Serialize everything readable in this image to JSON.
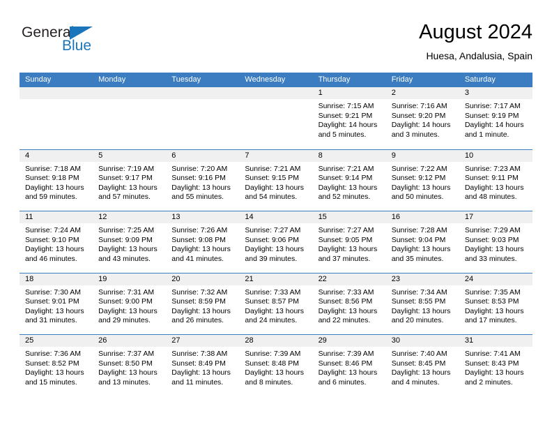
{
  "brand": {
    "name_top": "General",
    "name_bottom": "Blue",
    "accent_color": "#1b75bb",
    "triangle_icon": "triangle-icon"
  },
  "header": {
    "title": "August 2024",
    "subtitle": "Huesa, Andalusia, Spain"
  },
  "calendar": {
    "header_bg": "#3b7dc0",
    "day_head_bg": "#f0f0f0",
    "weekdays": [
      "Sunday",
      "Monday",
      "Tuesday",
      "Wednesday",
      "Thursday",
      "Friday",
      "Saturday"
    ],
    "weeks": [
      [
        {
          "day": "",
          "lines": []
        },
        {
          "day": "",
          "lines": []
        },
        {
          "day": "",
          "lines": []
        },
        {
          "day": "",
          "lines": []
        },
        {
          "day": "1",
          "lines": [
            "Sunrise: 7:15 AM",
            "Sunset: 9:21 PM",
            "Daylight: 14 hours",
            "and 5 minutes."
          ]
        },
        {
          "day": "2",
          "lines": [
            "Sunrise: 7:16 AM",
            "Sunset: 9:20 PM",
            "Daylight: 14 hours",
            "and 3 minutes."
          ]
        },
        {
          "day": "3",
          "lines": [
            "Sunrise: 7:17 AM",
            "Sunset: 9:19 PM",
            "Daylight: 14 hours",
            "and 1 minute."
          ]
        }
      ],
      [
        {
          "day": "4",
          "lines": [
            "Sunrise: 7:18 AM",
            "Sunset: 9:18 PM",
            "Daylight: 13 hours",
            "and 59 minutes."
          ]
        },
        {
          "day": "5",
          "lines": [
            "Sunrise: 7:19 AM",
            "Sunset: 9:17 PM",
            "Daylight: 13 hours",
            "and 57 minutes."
          ]
        },
        {
          "day": "6",
          "lines": [
            "Sunrise: 7:20 AM",
            "Sunset: 9:16 PM",
            "Daylight: 13 hours",
            "and 55 minutes."
          ]
        },
        {
          "day": "7",
          "lines": [
            "Sunrise: 7:21 AM",
            "Sunset: 9:15 PM",
            "Daylight: 13 hours",
            "and 54 minutes."
          ]
        },
        {
          "day": "8",
          "lines": [
            "Sunrise: 7:21 AM",
            "Sunset: 9:14 PM",
            "Daylight: 13 hours",
            "and 52 minutes."
          ]
        },
        {
          "day": "9",
          "lines": [
            "Sunrise: 7:22 AM",
            "Sunset: 9:12 PM",
            "Daylight: 13 hours",
            "and 50 minutes."
          ]
        },
        {
          "day": "10",
          "lines": [
            "Sunrise: 7:23 AM",
            "Sunset: 9:11 PM",
            "Daylight: 13 hours",
            "and 48 minutes."
          ]
        }
      ],
      [
        {
          "day": "11",
          "lines": [
            "Sunrise: 7:24 AM",
            "Sunset: 9:10 PM",
            "Daylight: 13 hours",
            "and 46 minutes."
          ]
        },
        {
          "day": "12",
          "lines": [
            "Sunrise: 7:25 AM",
            "Sunset: 9:09 PM",
            "Daylight: 13 hours",
            "and 43 minutes."
          ]
        },
        {
          "day": "13",
          "lines": [
            "Sunrise: 7:26 AM",
            "Sunset: 9:08 PM",
            "Daylight: 13 hours",
            "and 41 minutes."
          ]
        },
        {
          "day": "14",
          "lines": [
            "Sunrise: 7:27 AM",
            "Sunset: 9:06 PM",
            "Daylight: 13 hours",
            "and 39 minutes."
          ]
        },
        {
          "day": "15",
          "lines": [
            "Sunrise: 7:27 AM",
            "Sunset: 9:05 PM",
            "Daylight: 13 hours",
            "and 37 minutes."
          ]
        },
        {
          "day": "16",
          "lines": [
            "Sunrise: 7:28 AM",
            "Sunset: 9:04 PM",
            "Daylight: 13 hours",
            "and 35 minutes."
          ]
        },
        {
          "day": "17",
          "lines": [
            "Sunrise: 7:29 AM",
            "Sunset: 9:03 PM",
            "Daylight: 13 hours",
            "and 33 minutes."
          ]
        }
      ],
      [
        {
          "day": "18",
          "lines": [
            "Sunrise: 7:30 AM",
            "Sunset: 9:01 PM",
            "Daylight: 13 hours",
            "and 31 minutes."
          ]
        },
        {
          "day": "19",
          "lines": [
            "Sunrise: 7:31 AM",
            "Sunset: 9:00 PM",
            "Daylight: 13 hours",
            "and 29 minutes."
          ]
        },
        {
          "day": "20",
          "lines": [
            "Sunrise: 7:32 AM",
            "Sunset: 8:59 PM",
            "Daylight: 13 hours",
            "and 26 minutes."
          ]
        },
        {
          "day": "21",
          "lines": [
            "Sunrise: 7:33 AM",
            "Sunset: 8:57 PM",
            "Daylight: 13 hours",
            "and 24 minutes."
          ]
        },
        {
          "day": "22",
          "lines": [
            "Sunrise: 7:33 AM",
            "Sunset: 8:56 PM",
            "Daylight: 13 hours",
            "and 22 minutes."
          ]
        },
        {
          "day": "23",
          "lines": [
            "Sunrise: 7:34 AM",
            "Sunset: 8:55 PM",
            "Daylight: 13 hours",
            "and 20 minutes."
          ]
        },
        {
          "day": "24",
          "lines": [
            "Sunrise: 7:35 AM",
            "Sunset: 8:53 PM",
            "Daylight: 13 hours",
            "and 17 minutes."
          ]
        }
      ],
      [
        {
          "day": "25",
          "lines": [
            "Sunrise: 7:36 AM",
            "Sunset: 8:52 PM",
            "Daylight: 13 hours",
            "and 15 minutes."
          ]
        },
        {
          "day": "26",
          "lines": [
            "Sunrise: 7:37 AM",
            "Sunset: 8:50 PM",
            "Daylight: 13 hours",
            "and 13 minutes."
          ]
        },
        {
          "day": "27",
          "lines": [
            "Sunrise: 7:38 AM",
            "Sunset: 8:49 PM",
            "Daylight: 13 hours",
            "and 11 minutes."
          ]
        },
        {
          "day": "28",
          "lines": [
            "Sunrise: 7:39 AM",
            "Sunset: 8:48 PM",
            "Daylight: 13 hours",
            "and 8 minutes."
          ]
        },
        {
          "day": "29",
          "lines": [
            "Sunrise: 7:39 AM",
            "Sunset: 8:46 PM",
            "Daylight: 13 hours",
            "and 6 minutes."
          ]
        },
        {
          "day": "30",
          "lines": [
            "Sunrise: 7:40 AM",
            "Sunset: 8:45 PM",
            "Daylight: 13 hours",
            "and 4 minutes."
          ]
        },
        {
          "day": "31",
          "lines": [
            "Sunrise: 7:41 AM",
            "Sunset: 8:43 PM",
            "Daylight: 13 hours",
            "and 2 minutes."
          ]
        }
      ]
    ]
  }
}
